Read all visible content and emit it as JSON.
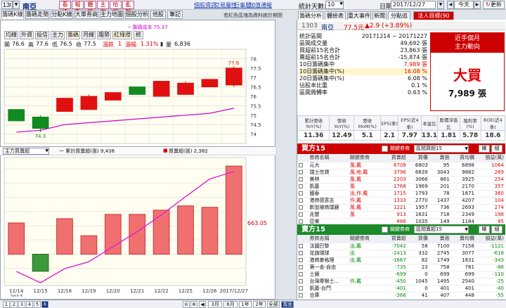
{
  "topbar": {
    "symbol": "1303",
    "stock_name": "南亞",
    "buttons": [
      "看法",
      "報告",
      "體檢",
      "主力",
      "哈拉",
      "亂報"
    ],
    "links": [
      "個股資訊",
      "交易屬性",
      "行事曆",
      "加值通報"
    ],
    "stats_label": "統計天數:",
    "stats_days": "10",
    "date_label": "日期:",
    "date": "2017/12/27",
    "today": "今天",
    "refresh": "更新"
  },
  "left_tabs": [
    "籌碼K線",
    "籌碼走勢",
    "分點K線",
    "大單券商",
    "主力地圖",
    "個股分析",
    "他股",
    "筆記"
  ],
  "left_notice": "若紅色區塊為資料統計期間",
  "indicator": {
    "toggles": [
      "均線",
      "外資",
      "投信",
      "主力",
      "籌碼",
      "月線",
      "趨勢",
      "紅綠燈",
      "統"
    ],
    "active_toggles": [
      "籌碼",
      "紅綠燈"
    ],
    "cost_label": "─ 籌碼成本 75.37"
  },
  "quote": {
    "open_label": "開",
    "open": "76.6",
    "high_label": "高",
    "high": "77.6",
    "low_label": "低",
    "low": "76.5",
    "close_label": "收",
    "close": "77.5",
    "change_label": "漲跌",
    "change": "1",
    "pct_label": "漲幅",
    "pct": "1.31%",
    "vol_label": "量",
    "vol": "6,836"
  },
  "vol_header": {
    "select": "主力買賣超",
    "line_legend": "一 累計買賣超(張) 9,438",
    "bar_legend": "買賣超(張) 2,382",
    "axis_badge": "663.05"
  },
  "chart_data": [
    {
      "type": "candlestick",
      "categories": [
        "12/14",
        "12/15",
        "12/18",
        "12/19",
        "12/20",
        "12/21",
        "12/22",
        "12/25",
        "12/26",
        "2017/12/27"
      ],
      "open": [
        75.3,
        74.9,
        75.2,
        75.3,
        75.8,
        76.5,
        76.0,
        76.1,
        76.5,
        76.6
      ],
      "close": [
        74.7,
        74.3,
        75.9,
        76.0,
        76.2,
        76.1,
        76.8,
        76.7,
        76.9,
        77.5
      ],
      "high": [
        75.3,
        75.0,
        75.9,
        76.1,
        76.2,
        76.5,
        76.8,
        76.8,
        76.9,
        77.6
      ],
      "low": [
        74.7,
        74.1,
        75.2,
        75.3,
        75.8,
        76.1,
        76.0,
        76.1,
        76.5,
        76.5
      ],
      "cost_line": [
        74.1,
        74.2,
        74.5,
        74.6,
        74.7,
        74.8,
        74.9,
        75.0,
        75.1,
        75.37
      ],
      "ylim": [
        73.5,
        78.5
      ],
      "yticks": [
        74,
        74.5,
        75,
        75.5,
        76,
        76.5,
        77,
        77.5,
        78
      ],
      "labels": [
        "77.6",
        "74.3"
      ]
    },
    {
      "type": "bar",
      "categories": [
        "12/14",
        "12/15",
        "12/18",
        "12/19",
        "12/20",
        "12/21",
        "12/22",
        "12/25",
        "12/26",
        "2017/12/27"
      ],
      "values": [
        1100,
        -600,
        1250,
        650,
        1400,
        1400,
        1550,
        1700,
        1650,
        3100
      ],
      "cumulative_line": [
        150,
        -900,
        400,
        1050,
        2450,
        3850,
        5400,
        7100,
        8750,
        9438
      ],
      "ylim": [
        -1100,
        3400
      ],
      "yticks": [
        -1000,
        -500,
        0,
        500,
        1000,
        1500,
        2000,
        2500,
        3000
      ],
      "year": "2017"
    }
  ],
  "bottom_buttons": [
    "1",
    "2",
    "3",
    "4",
    "5",
    "6"
  ],
  "bottom_ranges": [
    "3月",
    "6月",
    "1年",
    "2年",
    "全部",
    "寬面"
  ],
  "right_tabs": [
    "籌碼分析",
    "體檢表",
    "重大事件",
    "新聞",
    "分點追蹤",
    "法人目標(90元)"
  ],
  "right_header": {
    "code": "1303",
    "name": "南亞",
    "price": "77.5元",
    "change": "▲2.9 (+3.89%)"
  },
  "details": [
    {
      "label": "統計區間",
      "value": "20171214 ~ 20171227"
    },
    {
      "label": "區間成交量",
      "value": "49,692 張"
    },
    {
      "label": "買超前15名合計",
      "value": "23,863 張"
    },
    {
      "label": "賣超前15名合計",
      "value": "-15,874 張"
    },
    {
      "label": "10日籌碼集中",
      "value": "7,989 張"
    },
    {
      "label": "10日籌碼集中(%)",
      "value": "16.08 %"
    },
    {
      "label": "20日籌碼集中(%)",
      "value": "6.08 %"
    },
    {
      "label": "佔股本比重",
      "value": "0.1 %"
    },
    {
      "label": "區間周轉率",
      "value": "0.63 %"
    }
  ],
  "recommendation": {
    "title": "近手個月",
    "subtitle": "主力動向",
    "signal": "大買",
    "amount": "7,989 張"
  },
  "fin_headers": [
    "累計營收YoY(%)",
    "營收YoY(%)",
    "營收MoM(%)",
    "EPS(季)",
    "EPS(近4季)",
    "本益比",
    "股價淨值比",
    "殖利率(%)",
    "ROE(近4季)"
  ],
  "fin_values": [
    "11.36",
    "12.49",
    "5.1",
    "2.1",
    "7.97",
    "13.1",
    "1.81",
    "5.78",
    "18.6"
  ],
  "buy_section": {
    "title": "買方15",
    "filter_label": "關鍵券商",
    "filter": "區間買超15",
    "btn1": "欄",
    "btn2": "細",
    "headers": [
      "券商名稱",
      "關鍵券商",
      "買賣超",
      "買價",
      "賣張",
      "買均價",
      "損益(萬)"
    ],
    "rows": [
      [
        "元大",
        "風,戴",
        "6708",
        "6803",
        "95",
        "6898",
        "1064"
      ],
      [
        "瑞士信貸",
        "風,地,戴",
        "3796",
        "6839",
        "3043",
        "9882",
        "269"
      ],
      [
        "美林",
        "風,戴",
        "2203",
        "3066",
        "861",
        "3925",
        "254"
      ],
      [
        "凱基",
        "風",
        "1768",
        "1969",
        "201",
        "2170",
        "357"
      ],
      [
        "國泰",
        "出,作,戴",
        "1715",
        "1793",
        "78",
        "1871",
        "360"
      ],
      [
        "港商德意志",
        "作,戴",
        "1333",
        "2770",
        "1437",
        "4207",
        "104"
      ],
      [
        "新加坡商瑞銀",
        "風,戴",
        "1221",
        "1957",
        "736",
        "2693",
        "274"
      ],
      [
        "兆豐",
        "風",
        "913",
        "1631",
        "718",
        "2349",
        "198"
      ],
      [
        "亞東",
        "",
        "886",
        "1035",
        "149",
        "1184",
        "85"
      ]
    ]
  },
  "sell_section": {
    "title": "賣方15",
    "filter_label": "關鍵券商",
    "filter": "區間賣超15",
    "btn1": "欄",
    "btn2": "細",
    "headers": [
      "券商名稱",
      "關鍵券商",
      "買賣超",
      "買價",
      "賣張",
      "賣均價",
      "損益(萬)"
    ],
    "rows": [
      [
        "法國巴黎",
        "出,戴",
        "-7042",
        "58",
        "7100",
        "7158",
        "-1121"
      ],
      [
        "花旗環球",
        "出",
        "-2413",
        "332",
        "2745",
        "3077",
        "-618"
      ],
      [
        "港商麥格理",
        "出,戴",
        "-1667",
        "82",
        "1749",
        "1831",
        "-343"
      ],
      [
        "第一金-自由",
        "",
        "-735",
        "23",
        "758",
        "781",
        "-86"
      ],
      [
        "土銀",
        "",
        "-699",
        "0",
        "699",
        "699",
        "-110"
      ],
      [
        "台灣摩根士...",
        "作,戴",
        "-450",
        "1045",
        "1495",
        "2540",
        "-25"
      ],
      [
        "凱基-台門",
        "",
        "-401",
        "0",
        "401",
        "401",
        "-40"
      ],
      [
        "合庫",
        "",
        "-366",
        "41",
        "407",
        "448",
        "-55"
      ]
    ]
  }
}
